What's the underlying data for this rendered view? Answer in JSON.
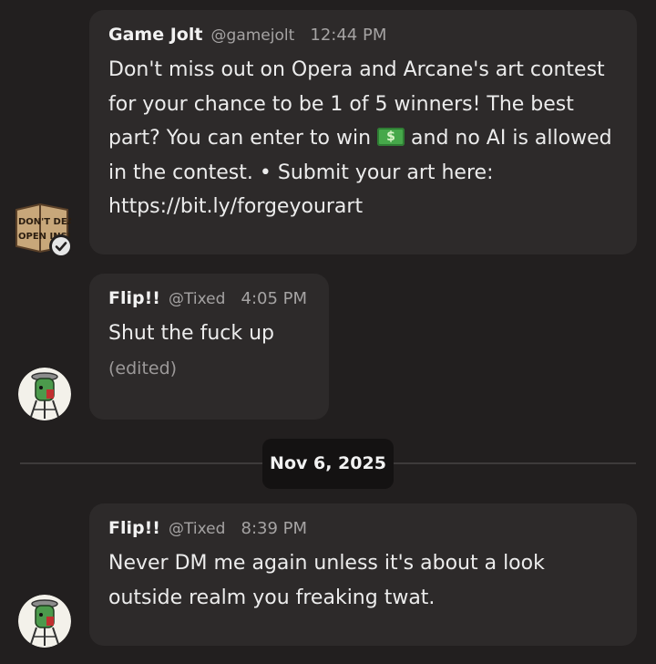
{
  "messages": [
    {
      "author": "Game Jolt",
      "handle": "@gamejolt",
      "time": "12:44 PM",
      "text_before_emoji": "Don't miss out on Opera and Arcane's art contest for your chance to be 1 of 5 winners! The best part? You can enter to win",
      "emoji": "money-banknote-emoji",
      "text_after_emoji": "and no AI is allowed in the contest. • Submit your art here: https://bit.ly/forgeyourart",
      "avatar_text_1": "DON'T DEAD",
      "avatar_text_2": "OPEN INSIDE"
    },
    {
      "author": "Flip!!",
      "handle": "@Tixed",
      "time": "4:05 PM",
      "text": "Shut the fuck up",
      "edited": "(edited)"
    },
    {
      "author": "Flip!!",
      "handle": "@Tixed",
      "time": "8:39 PM",
      "text": "Never DM me again unless it's about a look outside realm you freaking twat."
    }
  ],
  "date_divider": "Nov 6, 2025",
  "colors": {
    "background": "#221f1f",
    "bubble": "#2d2a2a",
    "date_pill": "#141212",
    "muted_text": "#a5a3a3"
  }
}
